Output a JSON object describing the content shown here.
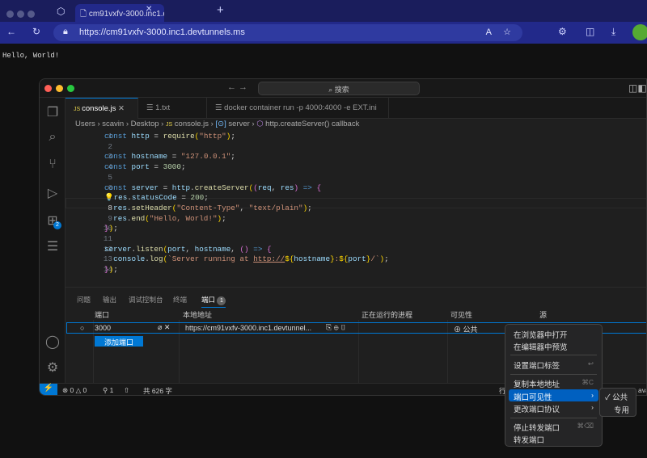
{
  "browser": {
    "tab_title": "cm91vxfv-3000.inc1.devtunnels.ms",
    "url": "https://cm91vxfv-3000.inc1.devtunnels.ms",
    "page_text": "Hello, World!"
  },
  "vscode": {
    "search_placeholder": "搜索",
    "tabs": [
      {
        "label": "console.js",
        "icon": "JS"
      },
      {
        "label": "1.txt"
      },
      {
        "label": "docker container run -p 4000:4000 -e EXT.ini"
      }
    ],
    "breadcrumb": [
      "Users",
      "scavin",
      "Desktop",
      "console.js",
      "server",
      "http.createServer() callback"
    ],
    "extensions_badge": "2",
    "code_lines": [
      "1",
      "2",
      "3",
      "4",
      "5",
      "6",
      "7",
      "8",
      "9",
      "10",
      "11",
      "12",
      "13",
      "14"
    ],
    "panel": {
      "tabs": [
        "问题",
        "输出",
        "调试控制台",
        "终端",
        "端口"
      ],
      "ports_badge": "1",
      "headers": [
        "端口",
        "本地地址",
        "正在运行的进程",
        "可见性",
        "源"
      ],
      "rows": [
        {
          "port": "3000",
          "address": "https://cm91vxfv-3000.inc1.devtunnel...",
          "visibility": "公共"
        }
      ],
      "add_port": "添加端口"
    },
    "status": {
      "errors": "0",
      "warnings": "0",
      "ports": "1",
      "chars": "共 626 字",
      "right_partial": "行",
      "lang_partial": "ava"
    }
  },
  "context_menu": {
    "items": [
      "在浏览器中打开",
      "在编辑器中预览",
      "设置端口标签",
      "复制本地地址",
      "端口可见性",
      "更改端口协议",
      "停止转发端口",
      "转发端口"
    ],
    "shortcuts": {
      "copy": "⌘C",
      "stop": "⌘⌫",
      "label": "↩"
    },
    "submenu": [
      "公共",
      "专用"
    ],
    "accent": "#0060c0"
  }
}
